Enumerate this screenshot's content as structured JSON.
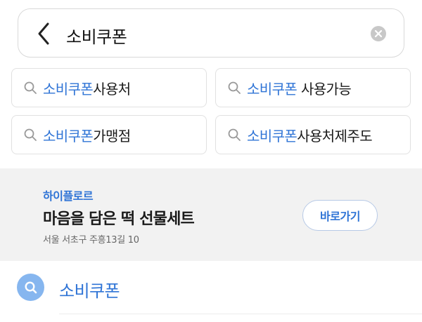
{
  "search": {
    "query": "소비쿠폰",
    "back_icon": "chevron-left-icon",
    "clear_icon": "clear-circle-icon"
  },
  "suggestions": [
    {
      "highlight": "소비쿠폰",
      "rest": "사용처"
    },
    {
      "highlight": "소비쿠폰",
      "rest": " 사용가능"
    },
    {
      "highlight": "소비쿠폰",
      "rest": "가맹점"
    },
    {
      "highlight": "소비쿠폰",
      "rest": "사용처제주도"
    }
  ],
  "ad": {
    "brand": "하이플로르",
    "title": "마음을 담은 떡 선물세트",
    "address": "서울 서초구 주흥13길 10",
    "button_label": "바로가기"
  },
  "result": {
    "label": "소비쿠폰",
    "icon": "search-icon"
  },
  "colors": {
    "accent": "#2f74d6",
    "result_icon_bg": "#86b6ef",
    "ad_bg": "#f2f2f2"
  }
}
